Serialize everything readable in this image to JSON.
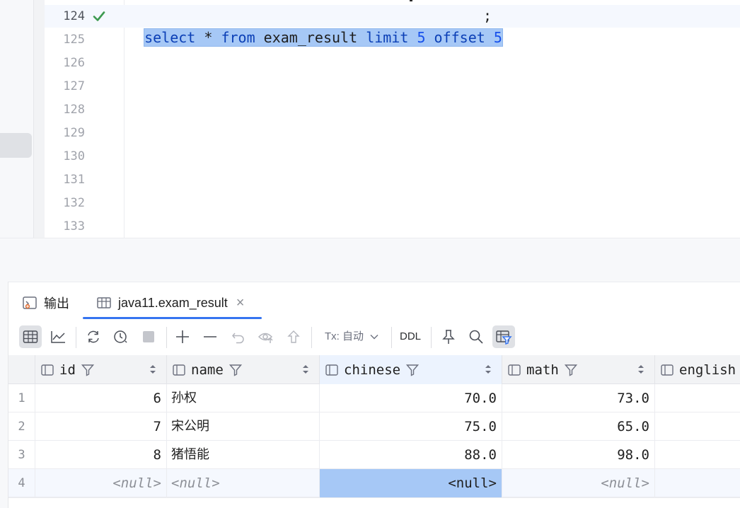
{
  "editor": {
    "lines": [
      {
        "number": "124",
        "active": true
      },
      {
        "number": "125"
      },
      {
        "number": "126"
      },
      {
        "number": "127"
      },
      {
        "number": "128"
      },
      {
        "number": "129"
      },
      {
        "number": "130"
      },
      {
        "number": "131"
      },
      {
        "number": "132"
      },
      {
        "number": "133"
      }
    ],
    "code": {
      "select": "select",
      "star": " * ",
      "from": "from",
      "table": " exam_result ",
      "limit": "limit",
      "limit_value": " 5 ",
      "offset": "offset",
      "offset_value": " 5",
      "semicolon": ";"
    },
    "status_icon": "check-icon",
    "colors": {
      "keyword": "#0b3fb6",
      "number": "#1750eb",
      "selection": "#a6c8f6",
      "success": "#3d9a50"
    }
  },
  "results": {
    "tabs": [
      {
        "label": "输出",
        "icon": "output-icon"
      },
      {
        "label": "java11.exam_result",
        "icon": "table-icon",
        "active": true
      }
    ],
    "toolbar": {
      "tx_label": "Tx: 自动",
      "ddl_label": "DDL"
    },
    "columns": [
      {
        "name": "id"
      },
      {
        "name": "name"
      },
      {
        "name": "chinese",
        "selected": true
      },
      {
        "name": "math"
      },
      {
        "name": "english"
      }
    ],
    "rows": [
      {
        "num": "1",
        "id": "6",
        "name": "孙权",
        "chinese": "70.0",
        "math": "73.0"
      },
      {
        "num": "2",
        "id": "7",
        "name": "宋公明",
        "chinese": "75.0",
        "math": "65.0"
      },
      {
        "num": "3",
        "id": "8",
        "name": "猪悟能",
        "chinese": "88.0",
        "math": "98.0"
      },
      {
        "num": "4",
        "id": "<null>",
        "name": "<null>",
        "chinese": "<null>",
        "math": "<null>"
      }
    ],
    "accent_color": "#3574f0"
  }
}
